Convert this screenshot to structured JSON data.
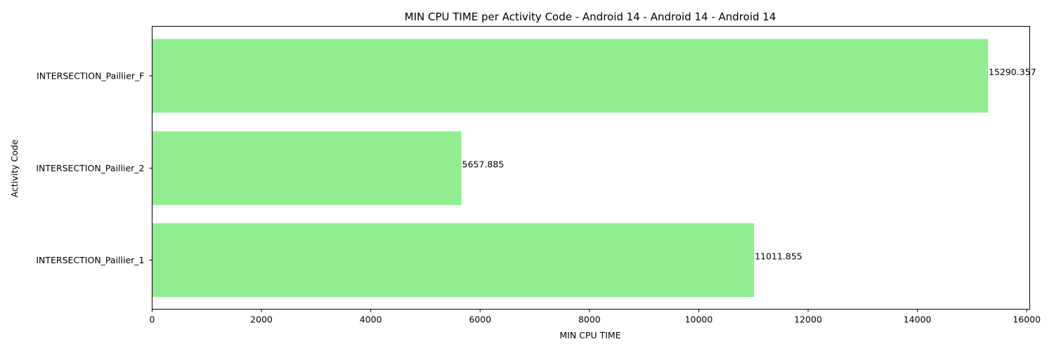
{
  "chart_data": {
    "type": "bar",
    "orientation": "horizontal",
    "title": "MIN CPU TIME per Activity Code - Android 14 - Android 14 - Android 14",
    "xlabel": "MIN CPU TIME",
    "ylabel": "Activity Code",
    "categories": [
      "INTERSECTION_Paillier_F",
      "INTERSECTION_Paillier_2",
      "INTERSECTION_Paillier_1"
    ],
    "values": [
      15290.357,
      5657.885,
      11011.855
    ],
    "data_labels": [
      "15290.357",
      "5657.885",
      "11011.855"
    ],
    "xlim": [
      0,
      16055
    ],
    "xticks": [
      0,
      2000,
      4000,
      6000,
      8000,
      10000,
      12000,
      14000,
      16000
    ],
    "xtick_labels": [
      "0",
      "2000",
      "4000",
      "6000",
      "8000",
      "10000",
      "12000",
      "14000",
      "16000"
    ],
    "grid": false,
    "legend": "none",
    "bar_color": "#90ee90"
  }
}
